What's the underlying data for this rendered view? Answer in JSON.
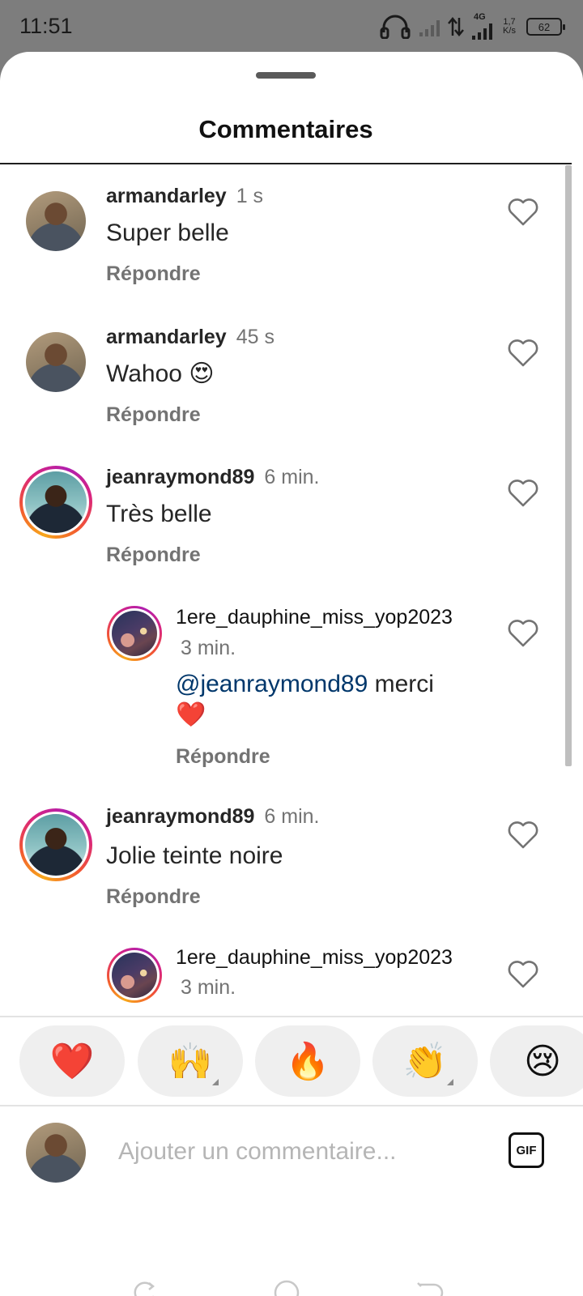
{
  "status_bar": {
    "time": "11:51",
    "network_type": "4G",
    "net_speed_value": "1,7",
    "net_speed_unit": "K/s",
    "battery": "62"
  },
  "sheet": {
    "title": "Commentaires"
  },
  "comments": [
    {
      "username": "armandarley",
      "time": "1 s",
      "text": "Super belle",
      "reply_label": "Répondre"
    },
    {
      "username": "armandarley",
      "time": "45 s",
      "text": "Wahoo 😍",
      "reply_label": "Répondre"
    },
    {
      "username": "jeanraymond89",
      "time": "6 min.",
      "text": "Très belle",
      "reply_label": "Répondre"
    },
    {
      "username": "1ere_dauphine_miss_yop2023",
      "time": "3 min.",
      "mention": "@jeanraymond89",
      "text": "merci",
      "emoji": "❤️",
      "reply_label": "Répondre"
    },
    {
      "username": "jeanraymond89",
      "time": "6 min.",
      "text": "Jolie teinte noire",
      "reply_label": "Répondre"
    },
    {
      "username": "1ere_dauphine_miss_yop2023",
      "time": "3 min."
    }
  ],
  "reactions": [
    "❤️",
    "🙌",
    "🔥",
    "👏",
    "😢"
  ],
  "input": {
    "placeholder": "Ajouter un commentaire...",
    "gif_label": "GIF"
  },
  "colors": {
    "link": "#00376b",
    "secondary_text": "#737373",
    "story_ring": [
      "#f7a71b",
      "#d9247f",
      "#b01fae"
    ]
  }
}
